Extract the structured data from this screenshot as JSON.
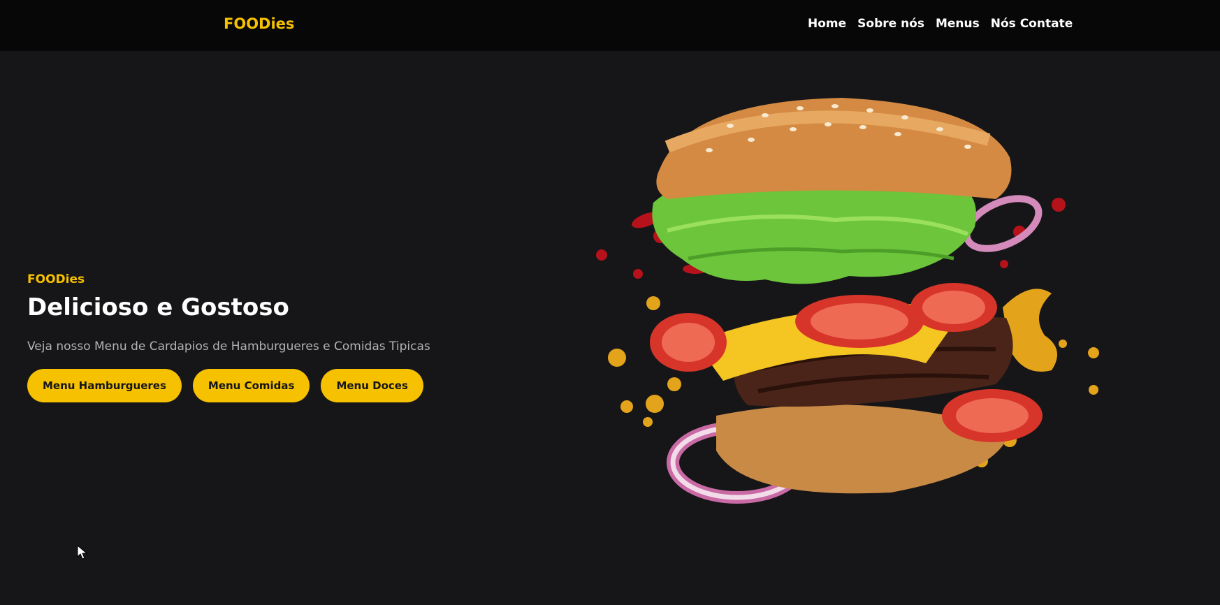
{
  "navbar": {
    "brand": "FOODies",
    "links": [
      "Home",
      "Sobre nós",
      "Menus",
      "Nós Contate"
    ]
  },
  "hero": {
    "brand": "FOODies",
    "title": "Delicioso e Gostoso",
    "subtitle": "Veja nosso Menu de Cardapios de Hamburgueres e Comidas Tipicas",
    "buttons": [
      "Menu Hamburgueres",
      "Menu Comidas",
      "Menu Doces"
    ]
  },
  "colors": {
    "accent": "#f6c100",
    "background": "#161618",
    "navbar": "#070708"
  }
}
